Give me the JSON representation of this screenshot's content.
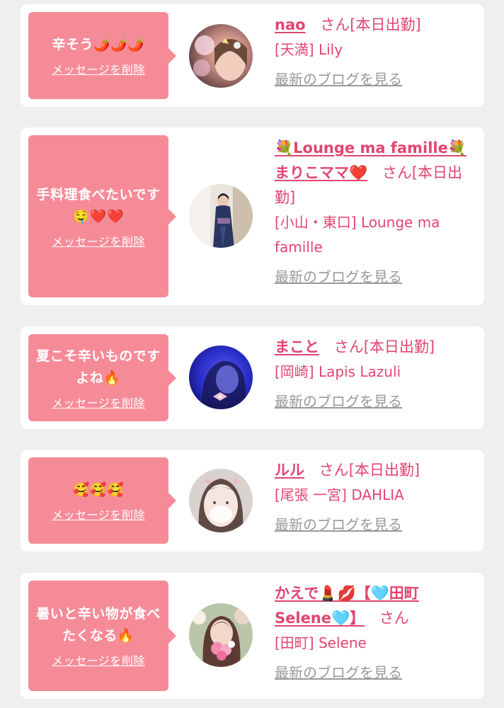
{
  "delete_label": "メッセージを削除",
  "blog_label": "最新のブログを見る",
  "san": "さん",
  "colors": {
    "bubble": "#f68b98",
    "name": "#e1456f",
    "blog_link": "#999999",
    "card_bg": "#ffffff",
    "page_bg": "#efefef"
  },
  "cards": [
    {
      "message": "辛そう🌶️🌶️🌶️",
      "name": "nao",
      "status": "[本日出勤]",
      "shop": "[天満] Lily",
      "avatar_icon": "girl-photo-avatar"
    },
    {
      "message": "手料理食べたいです🤤❤️❤️",
      "name": "💐Lounge ma famille💐まりこママ❤️",
      "status": "[本日出勤]",
      "shop": "[小山・東口] Lounge ma famille",
      "avatar_icon": "kimono-photo-avatar"
    },
    {
      "message": "夏こそ辛いものですよね🔥",
      "name": "まこと",
      "status": "[本日出勤]",
      "shop": "[岡崎] Lapis Lazuli",
      "avatar_icon": "blue-photo-avatar"
    },
    {
      "message": "🥰🥰🥰",
      "name": "ルル",
      "status": "[本日出勤]",
      "shop": "[尾張 一宮] DAHLIA",
      "avatar_icon": "bunny-filter-avatar"
    },
    {
      "message": "暑いと辛い物が食べたくなる🔥",
      "name": "かえで💄💋【🩵田町Selene🩵】",
      "status": "",
      "shop": "[田町] Selene",
      "avatar_icon": "flower-photo-avatar"
    }
  ]
}
